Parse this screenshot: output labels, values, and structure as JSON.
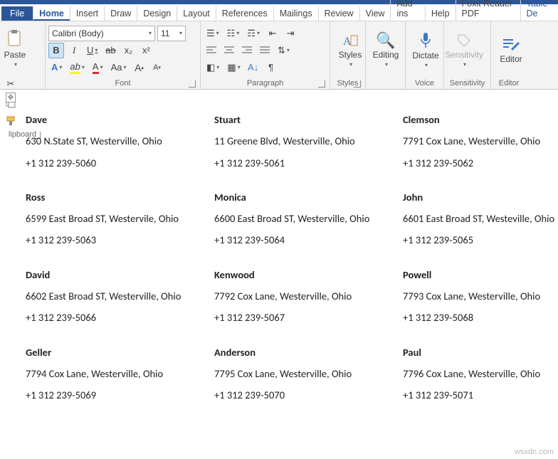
{
  "tabs": {
    "file": "File",
    "items": [
      "Home",
      "Insert",
      "Draw",
      "Design",
      "Layout",
      "References",
      "Mailings",
      "Review",
      "View",
      "Add-ins",
      "Help",
      "Foxit Reader PDF"
    ],
    "tableDesign": "Table De",
    "active": "Home"
  },
  "ribbon": {
    "clipboard": {
      "paste": "Paste",
      "label": "lipboard"
    },
    "font": {
      "name": "Calibri (Body)",
      "size": "11",
      "bold": "B",
      "italic": "I",
      "underline": "U",
      "strike": "ab",
      "sub": "x₂",
      "sup": "x²",
      "caseAa": "Aa",
      "grow": "A",
      "shrink": "A",
      "label": "Font"
    },
    "paragraph": {
      "label": "Paragraph"
    },
    "styles": {
      "btn": "Styles",
      "label": "Styles"
    },
    "editing": {
      "btn": "Editing"
    },
    "dictate": {
      "btn": "Dictate",
      "label": "Voice"
    },
    "sensitivity": {
      "btn": "Sensitivity",
      "label": "Sensitivity"
    },
    "editor": {
      "btn": "Editor",
      "label": "Editor"
    }
  },
  "labels": [
    {
      "name": "Dave",
      "addr": "630 N.State ST, Westerville, Ohio",
      "phone": "+1 312 239-5060"
    },
    {
      "name": "Stuart",
      "addr": "11 Greene Blvd, Westerville, Ohio",
      "phone": "+1 312 239-5061"
    },
    {
      "name": "Clemson",
      "addr": "7791 Cox Lane, Westerville, Ohio",
      "phone": "+1 312 239-5062"
    },
    {
      "name": "Ross",
      "addr": "6599 East Broad ST, Westervile, Ohio",
      "phone": "+1 312 239-5063"
    },
    {
      "name": "Monica",
      "addr": "6600 East Broad ST, Westerville, Ohio",
      "phone": "+1 312 239-5064"
    },
    {
      "name": "John",
      "addr": "6601 East Broad ST, Westeville, Ohio",
      "phone": "+1 312 239-5065"
    },
    {
      "name": "David",
      "addr": "6602 East Broad ST, Westerville, Ohio",
      "phone": "+1 312 239-5066"
    },
    {
      "name": "Kenwood",
      "addr": "7792 Cox Lane, Westerville, Ohio",
      "phone": "+1 312 239-5067"
    },
    {
      "name": "Powell",
      "addr": "7793 Cox Lane, Westerville, Ohio",
      "phone": "+1 312 239-5068"
    },
    {
      "name": "Geller",
      "addr": "7794 Cox Lane, Westerville, Ohio",
      "phone": "+1 312 239-5069"
    },
    {
      "name": "Anderson",
      "addr": "7795 Cox Lane, Westerville, Ohio",
      "phone": "+1 312 239-5070"
    },
    {
      "name": "Paul",
      "addr": "7796 Cox Lane, Westerville, Ohio",
      "phone": "+1 312 239-5071"
    }
  ],
  "watermark": "wsxdn.com"
}
